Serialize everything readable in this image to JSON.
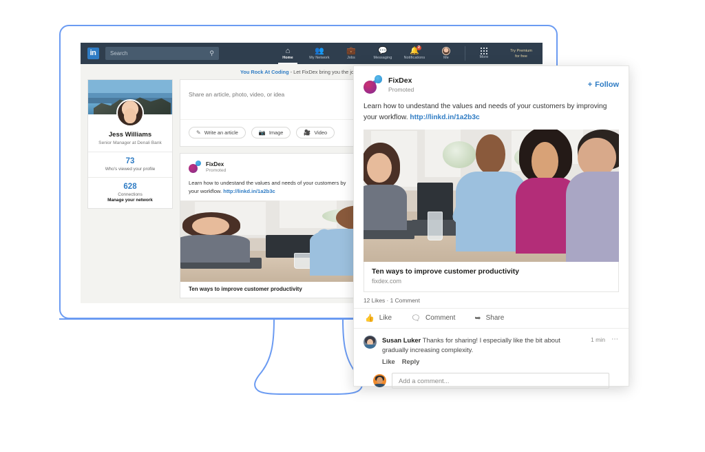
{
  "app": {
    "name": "LinkedIn",
    "logo_text": "in"
  },
  "nav": {
    "search_placeholder": "Search",
    "search_icon": "search-icon",
    "items": [
      {
        "label": "Home",
        "icon": "home-icon",
        "active": true,
        "badge": ""
      },
      {
        "label": "My Network",
        "icon": "people-icon",
        "active": false,
        "badge": ""
      },
      {
        "label": "Jobs",
        "icon": "briefcase-icon",
        "active": false,
        "badge": ""
      },
      {
        "label": "Messaging",
        "icon": "message-icon",
        "active": false,
        "badge": ""
      },
      {
        "label": "Notifications",
        "icon": "bell-icon",
        "active": false,
        "badge": "2"
      },
      {
        "label": "Me",
        "icon": "avatar-icon",
        "active": false,
        "badge": ""
      }
    ],
    "more_label": "More",
    "more_icon": "grid-icon",
    "premium_line1": "Try Premium",
    "premium_line2": "for free"
  },
  "banner": {
    "link_text": "You Rock At Coding",
    "rest_text": " - Let FixDex bring you the job offers. It's f"
  },
  "profile": {
    "name": "Jess Williams",
    "headline": "Senior Manager at Denali Bank",
    "views_count": "73",
    "views_label": "Who's viewed your profile",
    "connections_count": "628",
    "connections_label": "Connections",
    "manage_label": "Manage your network"
  },
  "share": {
    "placeholder": "Share an article, photo, video, or idea",
    "actions": [
      {
        "label": "Write an article",
        "icon": "pencil-square-icon"
      },
      {
        "label": "Image",
        "icon": "camera-icon"
      },
      {
        "label": "Video",
        "icon": "video-camera-icon"
      }
    ]
  },
  "feed_post": {
    "author": "FixDex",
    "promoted": "Promoted",
    "text_before": "Learn how to undestand the values and needs of your customers by",
    "text_after": "your workflow. ",
    "link": "http://linkd.in/1a2b3c",
    "photo_alt": "meeting-photo"
  },
  "overlay_post": {
    "author": "FixDex",
    "promoted": "Promoted",
    "follow_label": "Follow",
    "follow_icon": "plus-icon",
    "text": "Learn how to undestand the values and needs of your customers by improving your workflow. ",
    "link": "http://linkd.in/1a2b3c",
    "photo_alt": "meeting-photo",
    "link_title": "Ten ways to improve customer productivity",
    "link_domain": "fixdex.com",
    "stats": "12 Likes  ·  1 Comment",
    "actions": [
      {
        "label": "Like",
        "icon": "thumbs-up-icon"
      },
      {
        "label": "Comment",
        "icon": "comment-bubble-icon"
      },
      {
        "label": "Share",
        "icon": "share-arrow-icon"
      }
    ],
    "comment": {
      "author": "Susan Luker",
      "text": " Thanks for sharing! I especially like the bit about gradually increasing complexity.",
      "time": "1 min",
      "more_icon": "ellipsis-icon",
      "like_label": "Like",
      "reply_label": "Reply",
      "avatar": "susan-avatar"
    },
    "add_comment_placeholder": "Add a comment...",
    "add_comment_avatar": "user-avatar"
  },
  "colors": {
    "linkedin_blue": "#2f7cc4",
    "nav_bg": "#2f3e4e",
    "monitor_outline": "#6b9bf2",
    "badge_red": "#d94d36",
    "page_bg": "#f3f3f0"
  }
}
